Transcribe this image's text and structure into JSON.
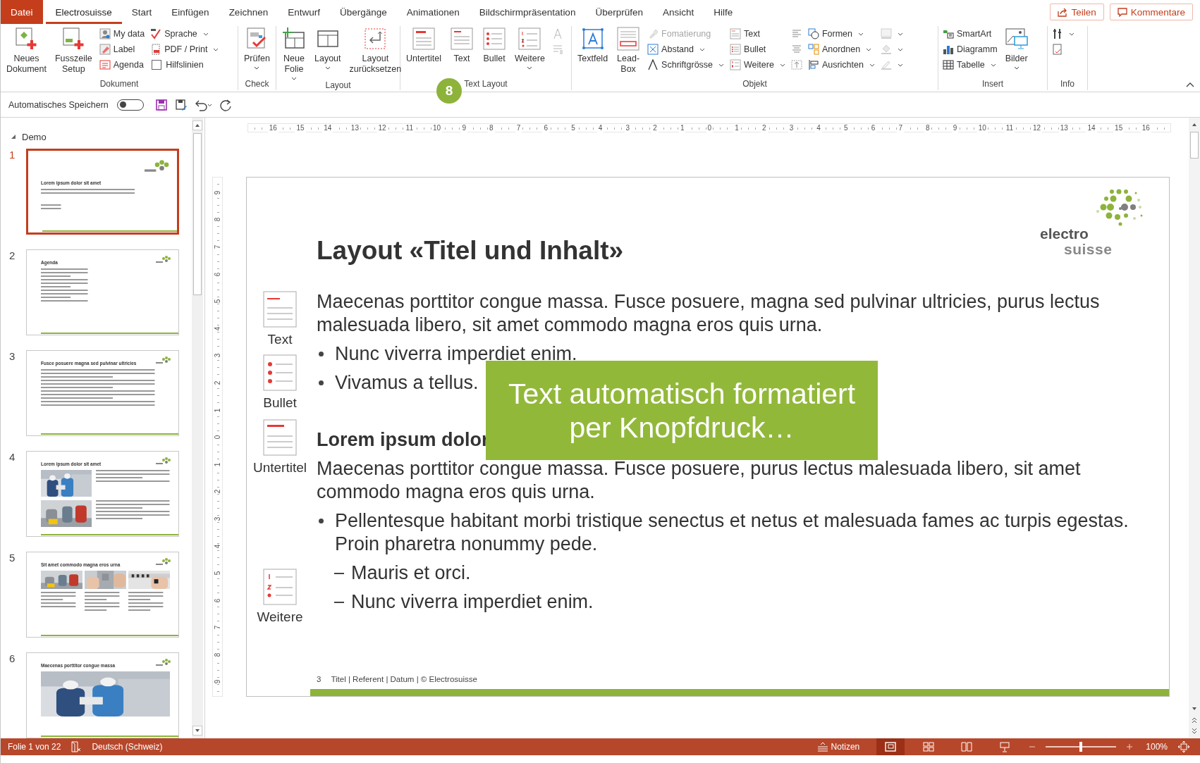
{
  "tabs": [
    {
      "label": "Datei",
      "kind": "file",
      "selected": false
    },
    {
      "label": "Electrosuisse",
      "kind": "tab",
      "selected": true
    },
    {
      "label": "Start",
      "kind": "tab",
      "selected": false
    },
    {
      "label": "Einfügen",
      "kind": "tab",
      "selected": false
    },
    {
      "label": "Zeichnen",
      "kind": "tab",
      "selected": false
    },
    {
      "label": "Entwurf",
      "kind": "tab",
      "selected": false
    },
    {
      "label": "Übergänge",
      "kind": "tab",
      "selected": false
    },
    {
      "label": "Animationen",
      "kind": "tab",
      "selected": false
    },
    {
      "label": "Bildschirmpräsentation",
      "kind": "tab",
      "selected": false
    },
    {
      "label": "Überprüfen",
      "kind": "tab",
      "selected": false
    },
    {
      "label": "Ansicht",
      "kind": "tab",
      "selected": false
    },
    {
      "label": "Hilfe",
      "kind": "tab",
      "selected": false
    }
  ],
  "share_button": "Teilen",
  "comments_button": "Kommentare",
  "ribbon_groups": [
    {
      "label": "Dokument",
      "items": [
        {
          "kind": "large",
          "label": "Neues Dokument",
          "menu": false
        },
        {
          "kind": "large",
          "label": "Fusszeile Setup",
          "menu": false
        },
        {
          "kind": "stack",
          "items": [
            {
              "kind": "button",
              "label": "My data",
              "menu": false,
              "disabled": false
            },
            {
              "kind": "button",
              "label": "Label",
              "menu": false,
              "disabled": false
            },
            {
              "kind": "button",
              "label": "Agenda",
              "menu": false,
              "disabled": false
            }
          ]
        },
        {
          "kind": "stack",
          "items": [
            {
              "kind": "button",
              "label": "Sprache",
              "menu": true,
              "disabled": false
            },
            {
              "kind": "button",
              "label": "PDF / Print",
              "menu": true,
              "disabled": false
            },
            {
              "kind": "checkbox",
              "label": "Hilfslinien",
              "checked": false,
              "disabled": false
            }
          ]
        }
      ]
    },
    {
      "label": "Check",
      "items": [
        {
          "kind": "large",
          "label": "Prüfen",
          "menu": true
        }
      ]
    },
    {
      "label": "Layout",
      "items": [
        {
          "kind": "large",
          "label": "Neue Folie",
          "menu": true
        },
        {
          "kind": "large",
          "label": "Layout",
          "menu": true
        },
        {
          "kind": "large",
          "label": "Layout zurücksetzen",
          "menu": false
        }
      ]
    },
    {
      "label": "Text Layout",
      "items": [
        {
          "kind": "large",
          "label": "Untertitel",
          "menu": false
        },
        {
          "kind": "large",
          "label": "Text",
          "menu": false
        },
        {
          "kind": "large",
          "label": "Bullet",
          "menu": false
        },
        {
          "kind": "large",
          "label": "Weitere",
          "menu": true
        },
        {
          "kind": "stack",
          "items": [
            {
              "kind": "button",
              "menu": false,
              "disabled": true
            },
            {
              "kind": "button",
              "menu": false,
              "disabled": true
            }
          ]
        }
      ]
    },
    {
      "label": "Objekt",
      "items": [
        {
          "kind": "large",
          "label": "Textfeld",
          "menu": false
        },
        {
          "kind": "large",
          "label": "Lead-Box",
          "menu": false
        },
        {
          "kind": "stack",
          "items": [
            {
              "kind": "button",
              "label": "Fomatierung",
              "menu": false,
              "disabled": true
            },
            {
              "kind": "button",
              "label": "Abstand",
              "menu": true,
              "disabled": false
            },
            {
              "kind": "button",
              "label": "Schriftgrösse",
              "menu": true,
              "disabled": false
            }
          ]
        },
        {
          "kind": "stack",
          "items": [
            {
              "kind": "button",
              "label": "Text",
              "menu": false,
              "disabled": false
            },
            {
              "kind": "button",
              "label": "Bullet",
              "menu": false,
              "disabled": false
            },
            {
              "kind": "button",
              "label": "Weitere",
              "menu": true,
              "disabled": false
            }
          ]
        },
        {
          "kind": "stack",
          "items": [
            {
              "kind": "button",
              "menu": false,
              "disabled": false
            },
            {
              "kind": "button",
              "menu": false,
              "disabled": false
            },
            {
              "kind": "button",
              "menu": false,
              "disabled": false
            }
          ]
        },
        {
          "kind": "stack",
          "items": [
            {
              "kind": "button",
              "label": "Formen",
              "menu": true,
              "disabled": false
            },
            {
              "kind": "button",
              "label": "Anordnen",
              "menu": true,
              "disabled": false
            },
            {
              "kind": "button",
              "label": "Ausrichten",
              "menu": true,
              "disabled": false
            }
          ]
        },
        {
          "kind": "stack",
          "items": [
            {
              "kind": "button",
              "menu": true,
              "disabled": true
            },
            {
              "kind": "button",
              "menu": true,
              "disabled": true
            },
            {
              "kind": "button",
              "menu": true,
              "disabled": true
            }
          ]
        }
      ]
    },
    {
      "label": "Insert",
      "items": [
        {
          "kind": "stack",
          "items": [
            {
              "kind": "button",
              "label": "SmartArt",
              "menu": false,
              "disabled": false
            },
            {
              "kind": "button",
              "label": "Diagramm",
              "menu": false,
              "disabled": false
            },
            {
              "kind": "button",
              "label": "Tabelle",
              "menu": true,
              "disabled": false
            }
          ]
        },
        {
          "kind": "large",
          "label": "Bilder",
          "menu": true
        }
      ]
    },
    {
      "label": "Info",
      "items": [
        {
          "kind": "stack",
          "items": [
            {
              "kind": "button",
              "menu": true,
              "disabled": false
            },
            {
              "kind": "button",
              "menu": false,
              "disabled": false
            }
          ]
        }
      ]
    }
  ],
  "step_badge": "8",
  "qat": {
    "autosave_label": "Automatisches Speichern",
    "autosave_on": false
  },
  "outline": {
    "section": "Demo",
    "expanded": true,
    "slides": [
      {
        "number": "1",
        "selected": true,
        "kind": "title",
        "title": "Lorem ipsum dolor sit amet"
      },
      {
        "number": "2",
        "selected": false,
        "kind": "list",
        "title": "Agenda"
      },
      {
        "number": "3",
        "selected": false,
        "kind": "text",
        "title": "Fusce posuere magna sed pulvinar ultricies"
      },
      {
        "number": "4",
        "selected": false,
        "kind": "photos2",
        "title": "Lorem ipsum dolor sit amet"
      },
      {
        "number": "5",
        "selected": false,
        "kind": "photos3",
        "title": "Sit amet commodo magna eros urna"
      },
      {
        "number": "6",
        "selected": false,
        "title": "Maecenas porttitor congue massa"
      }
    ]
  },
  "ruler_h": [
    "16",
    "15",
    "14",
    "13",
    "12",
    "11",
    "10",
    "9",
    "8",
    "7",
    "6",
    "5",
    "4",
    "3",
    "2",
    "1",
    "0",
    "1",
    "2",
    "3",
    "4",
    "5",
    "6",
    "7",
    "8",
    "9",
    "10",
    "11",
    "12",
    "13",
    "14",
    "15",
    "16"
  ],
  "ruler_v": [
    "9",
    "8",
    "7",
    "6",
    "5",
    "4",
    "3",
    "2",
    "1",
    "0",
    "1",
    "2",
    "3",
    "4",
    "5",
    "6",
    "7",
    "8",
    "9"
  ],
  "slide": {
    "title": "Layout «Titel und Inhalt»",
    "logo": [
      "electro",
      "suisse"
    ],
    "hints": [
      {
        "label": "Text",
        "kind": "text"
      },
      {
        "label": "Bullet",
        "kind": "bullet"
      },
      {
        "label": "Untertitel",
        "kind": "title"
      },
      {
        "label": "Weitere",
        "kind": "numbered"
      }
    ],
    "body": [
      {
        "kind": "para",
        "text": "Maecenas porttitor congue massa. Fusce posuere, magna sed pulvinar ultricies, purus lectus malesuada libero, sit amet commodo magna eros quis urna."
      },
      {
        "kind": "bullet",
        "text": "Nunc viverra imperdiet enim."
      },
      {
        "kind": "bullet",
        "text": "Vivamus a tellus."
      },
      {
        "kind": "heading",
        "text": "Lorem ipsum dolor"
      },
      {
        "kind": "para",
        "text": "Maecenas porttitor congue massa. Fusce posuere, purus lectus malesuada libero, sit amet commodo magna eros quis urna."
      },
      {
        "kind": "bullet",
        "text": "Pellentesque habitant morbi tristique senectus et netus et malesuada fames ac turpis egestas. Proin pharetra nonummy pede."
      },
      {
        "kind": "dash",
        "text": "Mauris et orci."
      },
      {
        "kind": "dash",
        "text": "Nunc viverra imperdiet enim."
      }
    ],
    "callout": "Text automatisch formatiert per Knopfdruck…",
    "footer_number": "3",
    "footer_text": "Titel | Referent | Datum | © Electrosuisse"
  },
  "status": {
    "slide_info": "Folie 1 von 22",
    "language": "Deutsch (Schweiz)",
    "notes_button": "Notizen",
    "views": [
      {
        "kind": "normal",
        "selected": true
      },
      {
        "kind": "sorter",
        "selected": false
      },
      {
        "kind": "reading",
        "selected": false
      },
      {
        "kind": "show",
        "selected": false
      }
    ],
    "zoom": {
      "level": 0.5,
      "reading": "100%"
    }
  }
}
